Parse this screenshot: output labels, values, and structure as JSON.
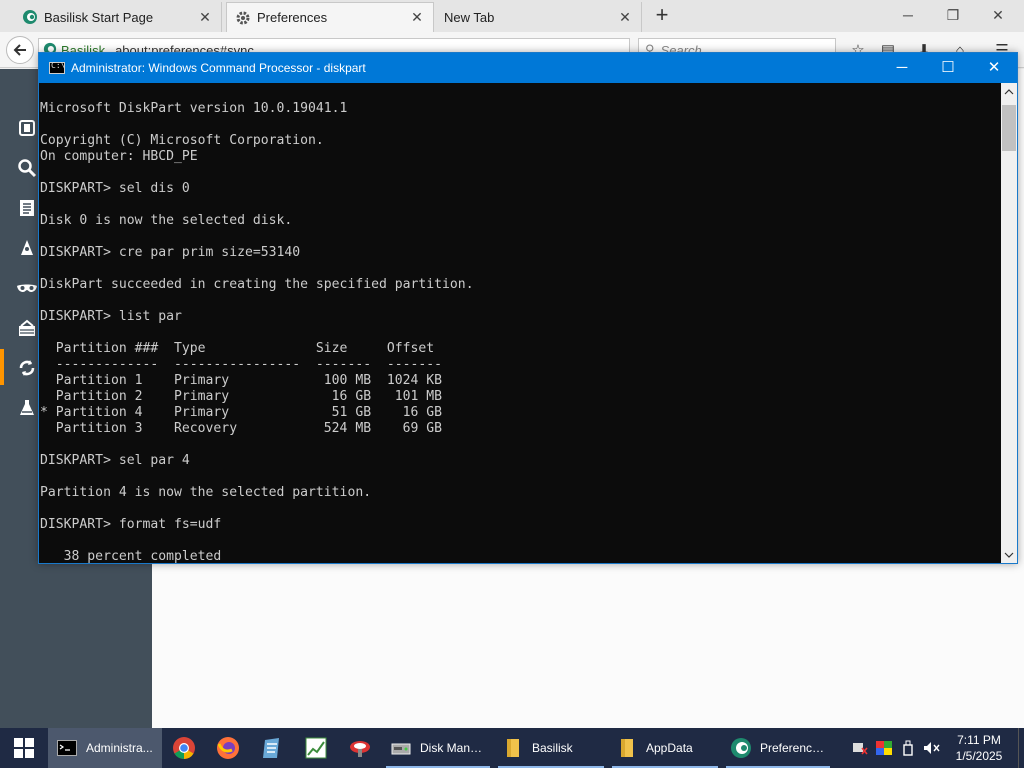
{
  "browser": {
    "tabs": [
      {
        "label": "Basilisk Start Page",
        "icon": "basilisk-icon"
      },
      {
        "label": "Preferences",
        "icon": "gear-icon"
      },
      {
        "label": "New Tab",
        "icon": ""
      }
    ],
    "url_site": "Basilisk",
    "url": "about:preferences#sync",
    "search_placeholder": "Search"
  },
  "cmd": {
    "title": "Administrator: Windows Command Processor - diskpart",
    "icon_text": "C:\\",
    "lines": [
      "Microsoft DiskPart version 10.0.19041.1",
      "",
      "Copyright (C) Microsoft Corporation.",
      "On computer: HBCD_PE",
      "",
      "DISKPART> sel dis 0",
      "",
      "Disk 0 is now the selected disk.",
      "",
      "DISKPART> cre par prim size=53140",
      "",
      "DiskPart succeeded in creating the specified partition.",
      "",
      "DISKPART> list par",
      "",
      "  Partition ###  Type              Size     Offset",
      "  -------------  ----------------  -------  -------",
      "  Partition 1    Primary            100 MB  1024 KB",
      "  Partition 2    Primary             16 GB   101 MB",
      "* Partition 4    Primary             51 GB    16 GB",
      "  Partition 3    Recovery           524 MB    69 GB",
      "",
      "DISKPART> sel par 4",
      "",
      "Partition 4 is now the selected partition.",
      "",
      "DISKPART> format fs=udf",
      "",
      "   38 percent completed"
    ]
  },
  "taskbar": {
    "items": [
      {
        "label": "Administra...",
        "icon": "cmd-icon"
      },
      {
        "label": "Disk Mana...",
        "icon": "disk-management-icon"
      },
      {
        "label": "Basilisk",
        "icon": "folder-icon"
      },
      {
        "label": "AppData",
        "icon": "folder-icon"
      },
      {
        "label": "Preference...",
        "icon": "basilisk-icon"
      }
    ],
    "time": "7:11 PM",
    "date": "1/5/2025"
  },
  "colors": {
    "cmd_titlebar": "#0078d7",
    "console_bg": "#0c0c0c",
    "console_text": "#cccccc",
    "pref_sidebar": "#424f5a",
    "taskbar": "#1f2a44"
  }
}
